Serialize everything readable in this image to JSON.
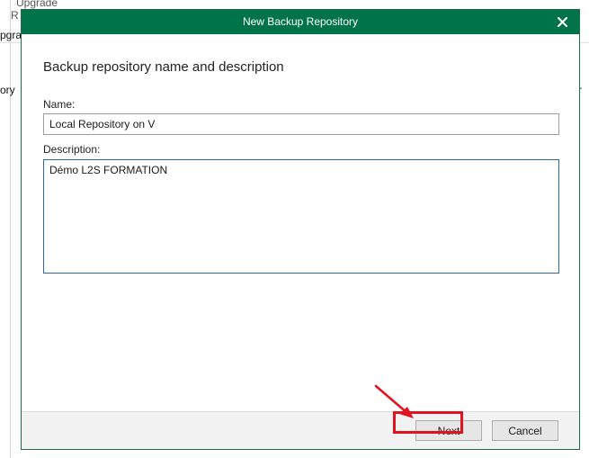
{
  "background": {
    "upgrade_label": "Upgrade",
    "r_fragment": "R",
    "upgra_fragment": "pgra",
    "ory_fragment": "ory",
    "r_right_fragment": "r"
  },
  "dialog": {
    "title": "New Backup Repository",
    "heading": "Backup repository name and description",
    "name_label": "Name:",
    "name_value": "Local Repository on V",
    "description_label": "Description:",
    "description_value": "Démo L2S FORMATION",
    "next_label": "Next",
    "cancel_label": "Cancel"
  },
  "colors": {
    "titlebar": "#00734a",
    "annotation": "#e0141e"
  },
  "icons": {
    "close": "close-icon",
    "annotation_arrow": "arrow-icon"
  }
}
